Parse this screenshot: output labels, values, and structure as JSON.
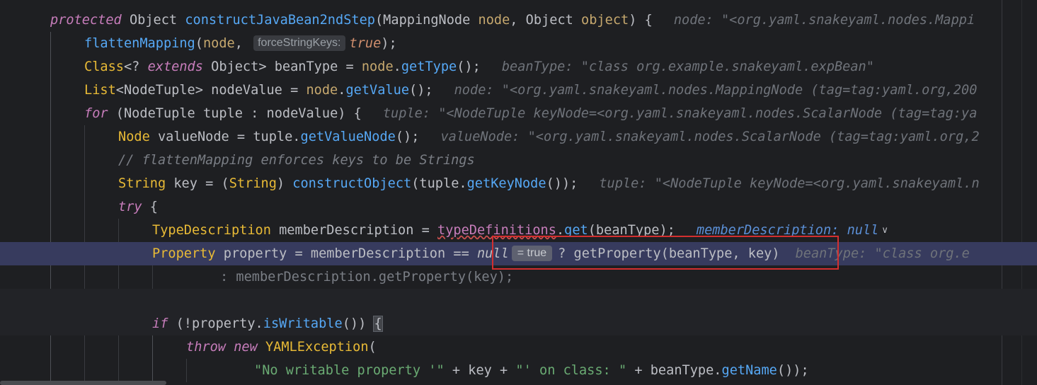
{
  "editor": {
    "lines": [
      {
        "tokens": [
          {
            "text": "protected",
            "cls": "kwi"
          },
          {
            "text": " Object ",
            "cls": "cls"
          },
          {
            "text": "constructJavaBean2ndStep",
            "cls": "fnd"
          },
          {
            "text": "(MappingNode ",
            "cls": "cls"
          },
          {
            "text": "node",
            "cls": "prm"
          },
          {
            "text": ", Object ",
            "cls": "cls"
          },
          {
            "text": "object",
            "cls": "prm"
          },
          {
            "text": ") {",
            "cls": "cls"
          }
        ],
        "hint": "node: \"<org.yaml.snakeyaml.nodes.Mappi"
      },
      {
        "tokens": [
          {
            "text": "flattenMapping",
            "cls": "fn"
          },
          {
            "text": "(",
            "cls": "cls"
          },
          {
            "text": "node",
            "cls": "prm"
          },
          {
            "text": ", ",
            "cls": "cls"
          }
        ],
        "param_hint": "forceStringKeys:",
        "tail": [
          {
            "text": "true",
            "cls": "nul"
          },
          {
            "text": ");",
            "cls": "cls"
          }
        ]
      },
      {
        "tokens": [
          {
            "text": "Class",
            "cls": "typ"
          },
          {
            "text": "<? ",
            "cls": "cls"
          },
          {
            "text": "extends",
            "cls": "kwi"
          },
          {
            "text": " Object> ",
            "cls": "cls"
          },
          {
            "text": "beanType",
            "cls": "var"
          },
          {
            "text": " = ",
            "cls": "cls"
          },
          {
            "text": "node",
            "cls": "prm"
          },
          {
            "text": ".",
            "cls": "cls"
          },
          {
            "text": "getType",
            "cls": "fn"
          },
          {
            "text": "();",
            "cls": "cls"
          }
        ],
        "hint": "beanType: \"class org.example.snakeyaml.expBean\""
      },
      {
        "tokens": [
          {
            "text": "List",
            "cls": "typ"
          },
          {
            "text": "<NodeTuple> ",
            "cls": "cls"
          },
          {
            "text": "nodeValue",
            "cls": "var"
          },
          {
            "text": " = ",
            "cls": "cls"
          },
          {
            "text": "node",
            "cls": "prm"
          },
          {
            "text": ".",
            "cls": "cls"
          },
          {
            "text": "getValue",
            "cls": "fn"
          },
          {
            "text": "();",
            "cls": "cls"
          }
        ],
        "hint": "node: \"<org.yaml.snakeyaml.nodes.MappingNode (tag=tag:yaml.org,200"
      },
      {
        "tokens": [
          {
            "text": "for",
            "cls": "kwi"
          },
          {
            "text": " (NodeTuple ",
            "cls": "cls"
          },
          {
            "text": "tuple",
            "cls": "var"
          },
          {
            "text": " : ",
            "cls": "cls"
          },
          {
            "text": "nodeValue",
            "cls": "var"
          },
          {
            "text": ") {",
            "cls": "cls"
          }
        ],
        "hint": "tuple: \"<NodeTuple keyNode=<org.yaml.snakeyaml.nodes.ScalarNode (tag=tag:ya"
      },
      {
        "tokens": [
          {
            "text": "Node",
            "cls": "typ"
          },
          {
            "text": " valueNode = ",
            "cls": "cls"
          },
          {
            "text": "tuple",
            "cls": "var"
          },
          {
            "text": ".",
            "cls": "cls"
          },
          {
            "text": "getValueNode",
            "cls": "fn"
          },
          {
            "text": "();",
            "cls": "cls"
          }
        ],
        "hint": "valueNode: \"<org.yaml.snakeyaml.nodes.ScalarNode (tag=tag:yaml.org,2"
      },
      {
        "tokens": [
          {
            "text": "// flattenMapping enforces keys to be Strings",
            "cls": "cmt"
          }
        ]
      },
      {
        "tokens": [
          {
            "text": "String",
            "cls": "typ"
          },
          {
            "text": " key = (",
            "cls": "cls"
          },
          {
            "text": "String",
            "cls": "typ"
          },
          {
            "text": ") ",
            "cls": "cls"
          },
          {
            "text": "constructObject",
            "cls": "fn"
          },
          {
            "text": "(",
            "cls": "cls"
          },
          {
            "text": "tuple",
            "cls": "var"
          },
          {
            "text": ".",
            "cls": "cls"
          },
          {
            "text": "getKeyNode",
            "cls": "fn"
          },
          {
            "text": "());",
            "cls": "cls"
          }
        ],
        "hint": "tuple: \"<NodeTuple keyNode=<org.yaml.snakeyaml.n"
      },
      {
        "tokens": [
          {
            "text": "try",
            "cls": "kwi"
          },
          {
            "text": " {",
            "cls": "cls"
          }
        ]
      },
      {
        "tokens": [
          {
            "text": "TypeDescription",
            "cls": "typ"
          },
          {
            "text": " memberDescription = ",
            "cls": "cls"
          },
          {
            "text": "typeDefinitions",
            "cls": "fldu"
          },
          {
            "text": ".",
            "cls": "cls"
          },
          {
            "text": "get",
            "cls": "fn"
          },
          {
            "text": "(beanType);",
            "cls": "cls"
          }
        ],
        "hintv": "memberDescription: null"
      },
      {
        "tokens": [
          {
            "text": "Property",
            "cls": "typ"
          },
          {
            "text": " property = memberDescription == ",
            "cls": "cls"
          },
          {
            "text": "null",
            "cls": "nulw"
          }
        ],
        "value_hint": "= true",
        "tail": [
          {
            "text": "? getProperty(beanType, key)",
            "cls": "cls"
          }
        ],
        "hint": "beanType: \"class org.e"
      },
      {
        "tokens": [
          {
            "text": ": memberDescription.getProperty(key);",
            "cls": "muted"
          }
        ]
      },
      {
        "tokens": []
      },
      {
        "tokens": [
          {
            "text": "if",
            "cls": "kwi"
          },
          {
            "text": " (!",
            "cls": "cls"
          },
          {
            "text": "property",
            "cls": "var"
          },
          {
            "text": ".",
            "cls": "cls"
          },
          {
            "text": "isWritable",
            "cls": "fn"
          },
          {
            "text": "()) ",
            "cls": "cls"
          }
        ],
        "brace": "{"
      },
      {
        "tokens": [
          {
            "text": "throw",
            "cls": "kwi"
          },
          {
            "text": " ",
            "cls": "cls"
          },
          {
            "text": "new",
            "cls": "kwi"
          },
          {
            "text": " ",
            "cls": "cls"
          },
          {
            "text": "YAMLException",
            "cls": "typ"
          },
          {
            "text": "(",
            "cls": "cls"
          }
        ]
      },
      {
        "tokens": [
          {
            "text": "\"No writable property '\"",
            "cls": "str"
          },
          {
            "text": " + key + ",
            "cls": "cls"
          },
          {
            "text": "\"' on class: \"",
            "cls": "str"
          },
          {
            "text": " + beanType.",
            "cls": "cls"
          },
          {
            "text": "getName",
            "cls": "fn"
          },
          {
            "text": "());",
            "cls": "cls"
          }
        ]
      }
    ]
  }
}
